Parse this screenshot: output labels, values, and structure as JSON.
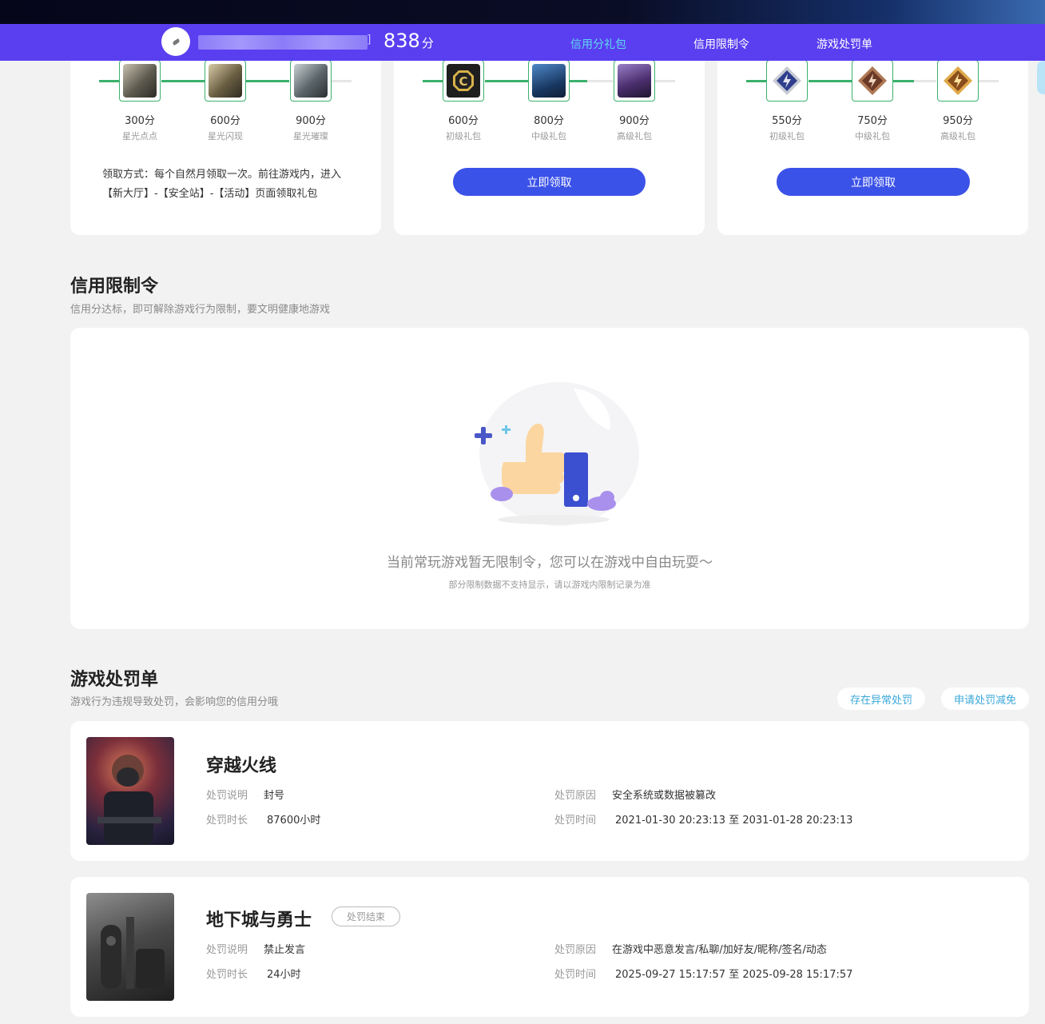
{
  "header": {
    "score": "838",
    "score_unit": "分",
    "bracket": "]",
    "tabs": [
      {
        "label": "信用分礼包",
        "active": true
      },
      {
        "label": "信用限制令",
        "active": false
      },
      {
        "label": "游戏处罚单",
        "active": false
      }
    ]
  },
  "gift_cards": [
    {
      "gifts": [
        {
          "score": "300分",
          "name": "星光点点"
        },
        {
          "score": "600分",
          "name": "星光闪现"
        },
        {
          "score": "900分",
          "name": "星光璀璨"
        }
      ],
      "claim_text": "领取方式：每个自然月领取一次。前往游戏内，进入【新大厅】-【安全站】-【活动】页面领取礼包"
    },
    {
      "gifts": [
        {
          "score": "600分",
          "name": "初级礼包"
        },
        {
          "score": "800分",
          "name": "中级礼包"
        },
        {
          "score": "900分",
          "name": "高级礼包"
        }
      ],
      "button": "立即领取"
    },
    {
      "gifts": [
        {
          "score": "550分",
          "name": "初级礼包"
        },
        {
          "score": "750分",
          "name": "中级礼包"
        },
        {
          "score": "950分",
          "name": "高级礼包"
        }
      ],
      "button": "立即领取"
    }
  ],
  "restriction": {
    "title": "信用限制令",
    "subtitle": "信用分达标，即可解除游戏行为限制，要文明健康地游戏",
    "empty_text": "当前常玩游戏暂无限制令，您可以在游戏中自由玩耍～",
    "empty_note": "部分限制数据不支持显示，请以游戏内限制记录为准"
  },
  "penalty": {
    "title": "游戏处罚单",
    "subtitle": "游戏行为违规导致处罚，会影响您的信用分哦",
    "btn_abnormal": "存在异常处罚",
    "btn_reduce": "申请处罚减免",
    "labels": {
      "desc": "处罚说明",
      "duration": "处罚时长",
      "reason": "处罚原因",
      "time": "处罚时间"
    },
    "items": [
      {
        "game": "穿越火线",
        "status": "",
        "desc": "封号",
        "duration": "87600小时",
        "reason": "安全系统或数据被篡改",
        "time": "2021-01-30 20:23:13 至 2031-01-28 20:23:13"
      },
      {
        "game": "地下城与勇士",
        "status": "处罚结束",
        "desc": "禁止发言",
        "duration": "24小时",
        "reason": "在游戏中恶意发言/私聊/加好友/昵称/签名/动态",
        "time": "2025-09-27 15:17:57 至 2025-09-28 15:17:57"
      }
    ]
  },
  "colors": {
    "nav_bg": "#5a3ff0",
    "active_tab": "#5ed8f2",
    "progress_green": "#3bb06d",
    "button_blue": "#3b52e8",
    "link_cyan": "#3aa8d8"
  }
}
